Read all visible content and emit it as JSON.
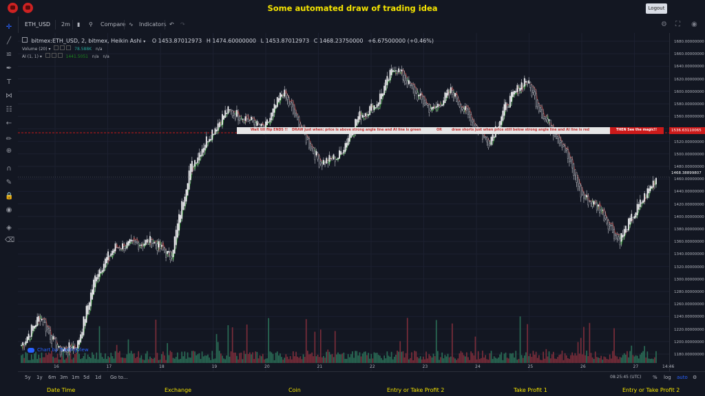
{
  "top": {
    "title": "Some automated draw of trading idea",
    "logout_label": "Logout"
  },
  "header": {
    "symbol": "ETH_USD",
    "interval": "2m",
    "compare_label": "Compare",
    "indicators_label": "Indicators"
  },
  "legend": {
    "main": "bitmex:ETH_USD, 2, bitmex, Heikin Ashi",
    "open": "O 1453.87012973",
    "high": "H 1474.60000000",
    "low": "L 1453.87012973",
    "close": "C 1468.23750000",
    "change": "+6.67500000 (+0.46%)",
    "volume_label": "Volume (20)",
    "volume_value": "78.588K",
    "volume_na": "n/a",
    "ai_label": "AI (1, 1)",
    "ai_value": "1441.5051",
    "ai_na1": "n/a",
    "ai_na2": "n/a"
  },
  "banner": {
    "text1": "Wait till flip ENDS !!",
    "text2": "DRAW just when:  price is above strong angle line and AI line is green",
    "text3": "OR",
    "text4": "draw shorts just when price still below strong angle line and AI line is red",
    "text5": "THEN See the magic!!"
  },
  "price_axis": {
    "labels": [
      "1680.00000000",
      "1660.00000000",
      "1640.00000000",
      "1620.00000000",
      "1600.00000000",
      "1580.00000000",
      "1560.00000000",
      "1540.00000000",
      "1520.00000000",
      "1500.00000000",
      "1480.00000000",
      "1460.00000000",
      "1440.00000000",
      "1420.00000000",
      "1400.00000000",
      "1380.00000000",
      "1360.00000000",
      "1340.00000000",
      "1320.00000000",
      "1300.00000000",
      "1280.00000000",
      "1260.00000000",
      "1240.00000000",
      "1220.00000000",
      "1200.00000000",
      "1180.00000000"
    ],
    "tag_red": "1536.63110065",
    "tag_current": "1468.38899807"
  },
  "time_axis": {
    "labels": [
      "16",
      "17",
      "18",
      "19",
      "20",
      "21",
      "22",
      "23",
      "24",
      "25",
      "26",
      "27"
    ],
    "end_label": "14:46"
  },
  "bottom_bar": {
    "ranges": [
      "5y",
      "1y",
      "6m",
      "3m",
      "1m",
      "5d",
      "1d"
    ],
    "goto": "Go to...",
    "clock": "08:25:45 (UTC)",
    "percent": "%",
    "log": "log",
    "auto": "auto"
  },
  "watermark": "Chart by TradingView",
  "footer": {
    "items": [
      "Date Time",
      "Exchange",
      "Coin",
      "Entry or Take Profit 2",
      "Take Profit 1",
      "Entry or Take Profit 2"
    ]
  },
  "colors": {
    "background": "#131722",
    "up": "#26a69a",
    "down": "#ef5350",
    "accent_yellow": "#f5e400",
    "ai_line_green": "#1e8a1e",
    "ai_line_red": "#8a1e1e"
  },
  "chart_data": {
    "type": "candlestick",
    "symbol": "bitmex:ETH_USD",
    "interval": "2",
    "style": "Heikin Ashi",
    "days": [
      "16",
      "17",
      "18",
      "19",
      "20",
      "21",
      "22",
      "23",
      "24",
      "25",
      "26",
      "27"
    ],
    "price_path": [
      1210,
      1255,
      1200,
      1210,
      1320,
      1360,
      1365,
      1370,
      1345,
      1480,
      1530,
      1570,
      1560,
      1540,
      1600,
      1540,
      1490,
      1500,
      1560,
      1580,
      1640,
      1600,
      1570,
      1600,
      1560,
      1520,
      1580,
      1620,
      1560,
      1520,
      1440,
      1420,
      1370,
      1420,
      1468
    ],
    "ylim": [
      1170,
      1690
    ],
    "horizontal_line": 1536.63,
    "last_price": 1468.39
  }
}
